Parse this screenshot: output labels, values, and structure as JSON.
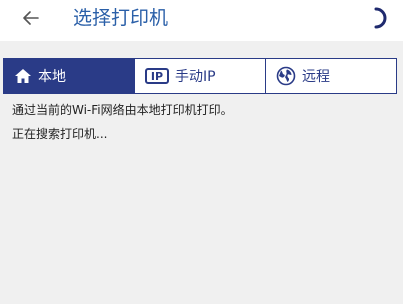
{
  "header": {
    "title": "选择打印机",
    "back_icon": "back-arrow-icon",
    "loading_icon": "loading-spinner-icon"
  },
  "tabs": [
    {
      "label": "本地",
      "icon": "home-icon",
      "active": true
    },
    {
      "label": "手动IP",
      "icon": "ip-icon",
      "icon_text": "IP",
      "active": false
    },
    {
      "label": "远程",
      "icon": "globe-icon",
      "active": false
    }
  ],
  "content": {
    "description": "通过当前的Wi-Fi网络由本地打印机打印。",
    "status": "正在搜索打印机..."
  },
  "colors": {
    "accent": "#2a3b87",
    "title": "#2a5fa8",
    "background": "#f0f0f0"
  }
}
